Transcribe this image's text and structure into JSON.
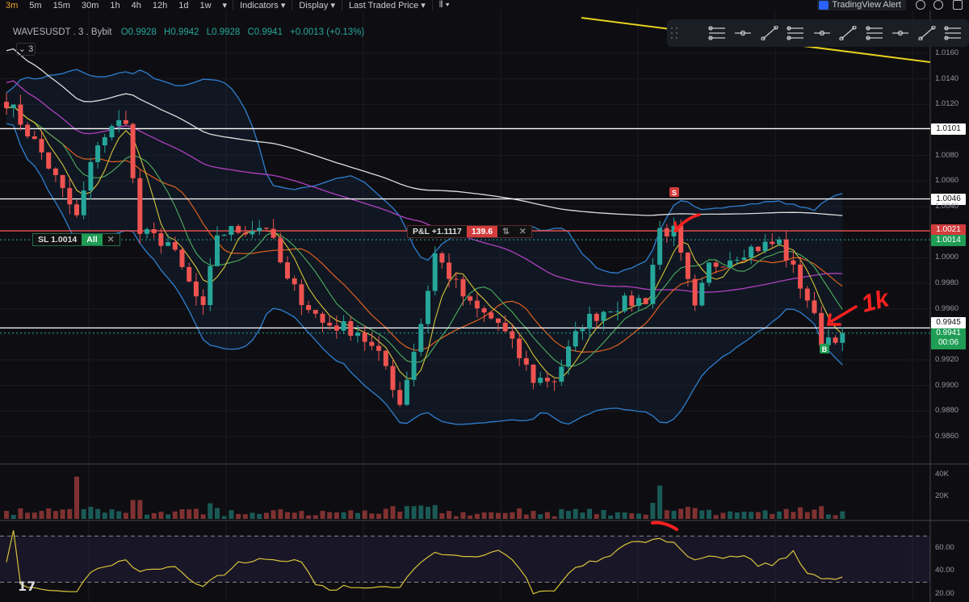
{
  "toolbar": {
    "timeframes": [
      "3m",
      "5m",
      "15m",
      "30m",
      "1h",
      "4h",
      "12h",
      "1d",
      "1w"
    ],
    "active": "3m",
    "more": "▾",
    "indicators": "Indicators ▾",
    "display": "Display ▾",
    "price_type": "Last Traded Price ▾",
    "chart_type": "⫴ ▾",
    "alert": "TradingView Alert"
  },
  "legend": {
    "symbol": "WAVESUSDT . 3 . Bybit",
    "open": "O0.9928",
    "high": "H0.9942",
    "low": "L0.9928",
    "close": "C0.9941",
    "change": "+0.0013 (+0.13%)",
    "collapse": "⌄ 3"
  },
  "orders": {
    "sl_label": "SL 1.0014",
    "sl_qty": "All",
    "pnl_label": "P&L +1.1117",
    "pnl_qty": "139.6",
    "close": "✕",
    "swap": "⇅"
  },
  "markers": {
    "sell": "S",
    "buy": "B"
  },
  "annotation": "1k",
  "price_labels": {
    "l1": "1.0101",
    "l2": "1.0046",
    "l3": "1.0021",
    "l4": "1.0014",
    "l5": "0.9945",
    "last": "0.9941",
    "countdown": "00:06"
  },
  "colors": {
    "up": "#26a69a",
    "down": "#ef5350",
    "bb": "#2f7fd0",
    "rsi": "#d8c43a"
  },
  "chart_data": {
    "type": "candlestick",
    "symbol": "WAVESUSDT",
    "interval": "3m",
    "ylim": [
      0.985,
      1.017
    ],
    "yticks": [
      "1.0160",
      "1.0140",
      "1.0120",
      "1.0080",
      "1.0060",
      "1.0040",
      "1.0000",
      "0.9980",
      "0.9960",
      "0.9920",
      "0.9900",
      "0.9880",
      "0.9860"
    ],
    "candle_count": 120,
    "close_keypoints": [
      [
        0,
        1.0123
      ],
      [
        5,
        1.0082
      ],
      [
        10,
        1.0031
      ],
      [
        13,
        1.0091
      ],
      [
        17,
        1.011
      ],
      [
        18,
        1.006
      ],
      [
        19,
        1.0019
      ],
      [
        23,
        1.0012
      ],
      [
        28,
        0.9958
      ],
      [
        30,
        1.0019
      ],
      [
        37,
        1.0025
      ],
      [
        40,
        0.9981
      ],
      [
        45,
        0.9949
      ],
      [
        50,
        0.9943
      ],
      [
        54,
        0.9915
      ],
      [
        56,
        0.9886
      ],
      [
        59,
        0.9949
      ],
      [
        61,
        1.0003
      ],
      [
        66,
        0.9962
      ],
      [
        70,
        0.9949
      ],
      [
        75,
        0.9905
      ],
      [
        78,
        0.9905
      ],
      [
        82,
        0.9949
      ],
      [
        86,
        0.9962
      ],
      [
        91,
        0.9968
      ],
      [
        93,
        1.0022
      ],
      [
        95,
        1.002
      ],
      [
        98,
        0.9958
      ],
      [
        100,
        0.9993
      ],
      [
        105,
        1.0006
      ],
      [
        110,
        1.0012
      ],
      [
        114,
        0.9968
      ],
      [
        116,
        0.9936
      ],
      [
        119,
        0.9941
      ]
    ],
    "hlines": [
      {
        "price": 1.0101,
        "color": "#ffffff"
      },
      {
        "price": 1.0046,
        "color": "#ffffff"
      },
      {
        "price": 1.0021,
        "color": "#ef5350"
      },
      {
        "price": 1.0014,
        "color": "#26a69a",
        "dotted": true
      },
      {
        "price": 0.9945,
        "color": "#ffffff"
      },
      {
        "price": 0.9941,
        "color": "#26a69a",
        "dotted": true
      }
    ],
    "volume": {
      "yticks": [
        "40K",
        "20K"
      ],
      "ylim": [
        0,
        45000
      ]
    },
    "rsi": {
      "yticks": [
        "60.00",
        "40.00",
        "20.00"
      ],
      "ylim": [
        15,
        80
      ],
      "bands": [
        70,
        30
      ]
    }
  }
}
